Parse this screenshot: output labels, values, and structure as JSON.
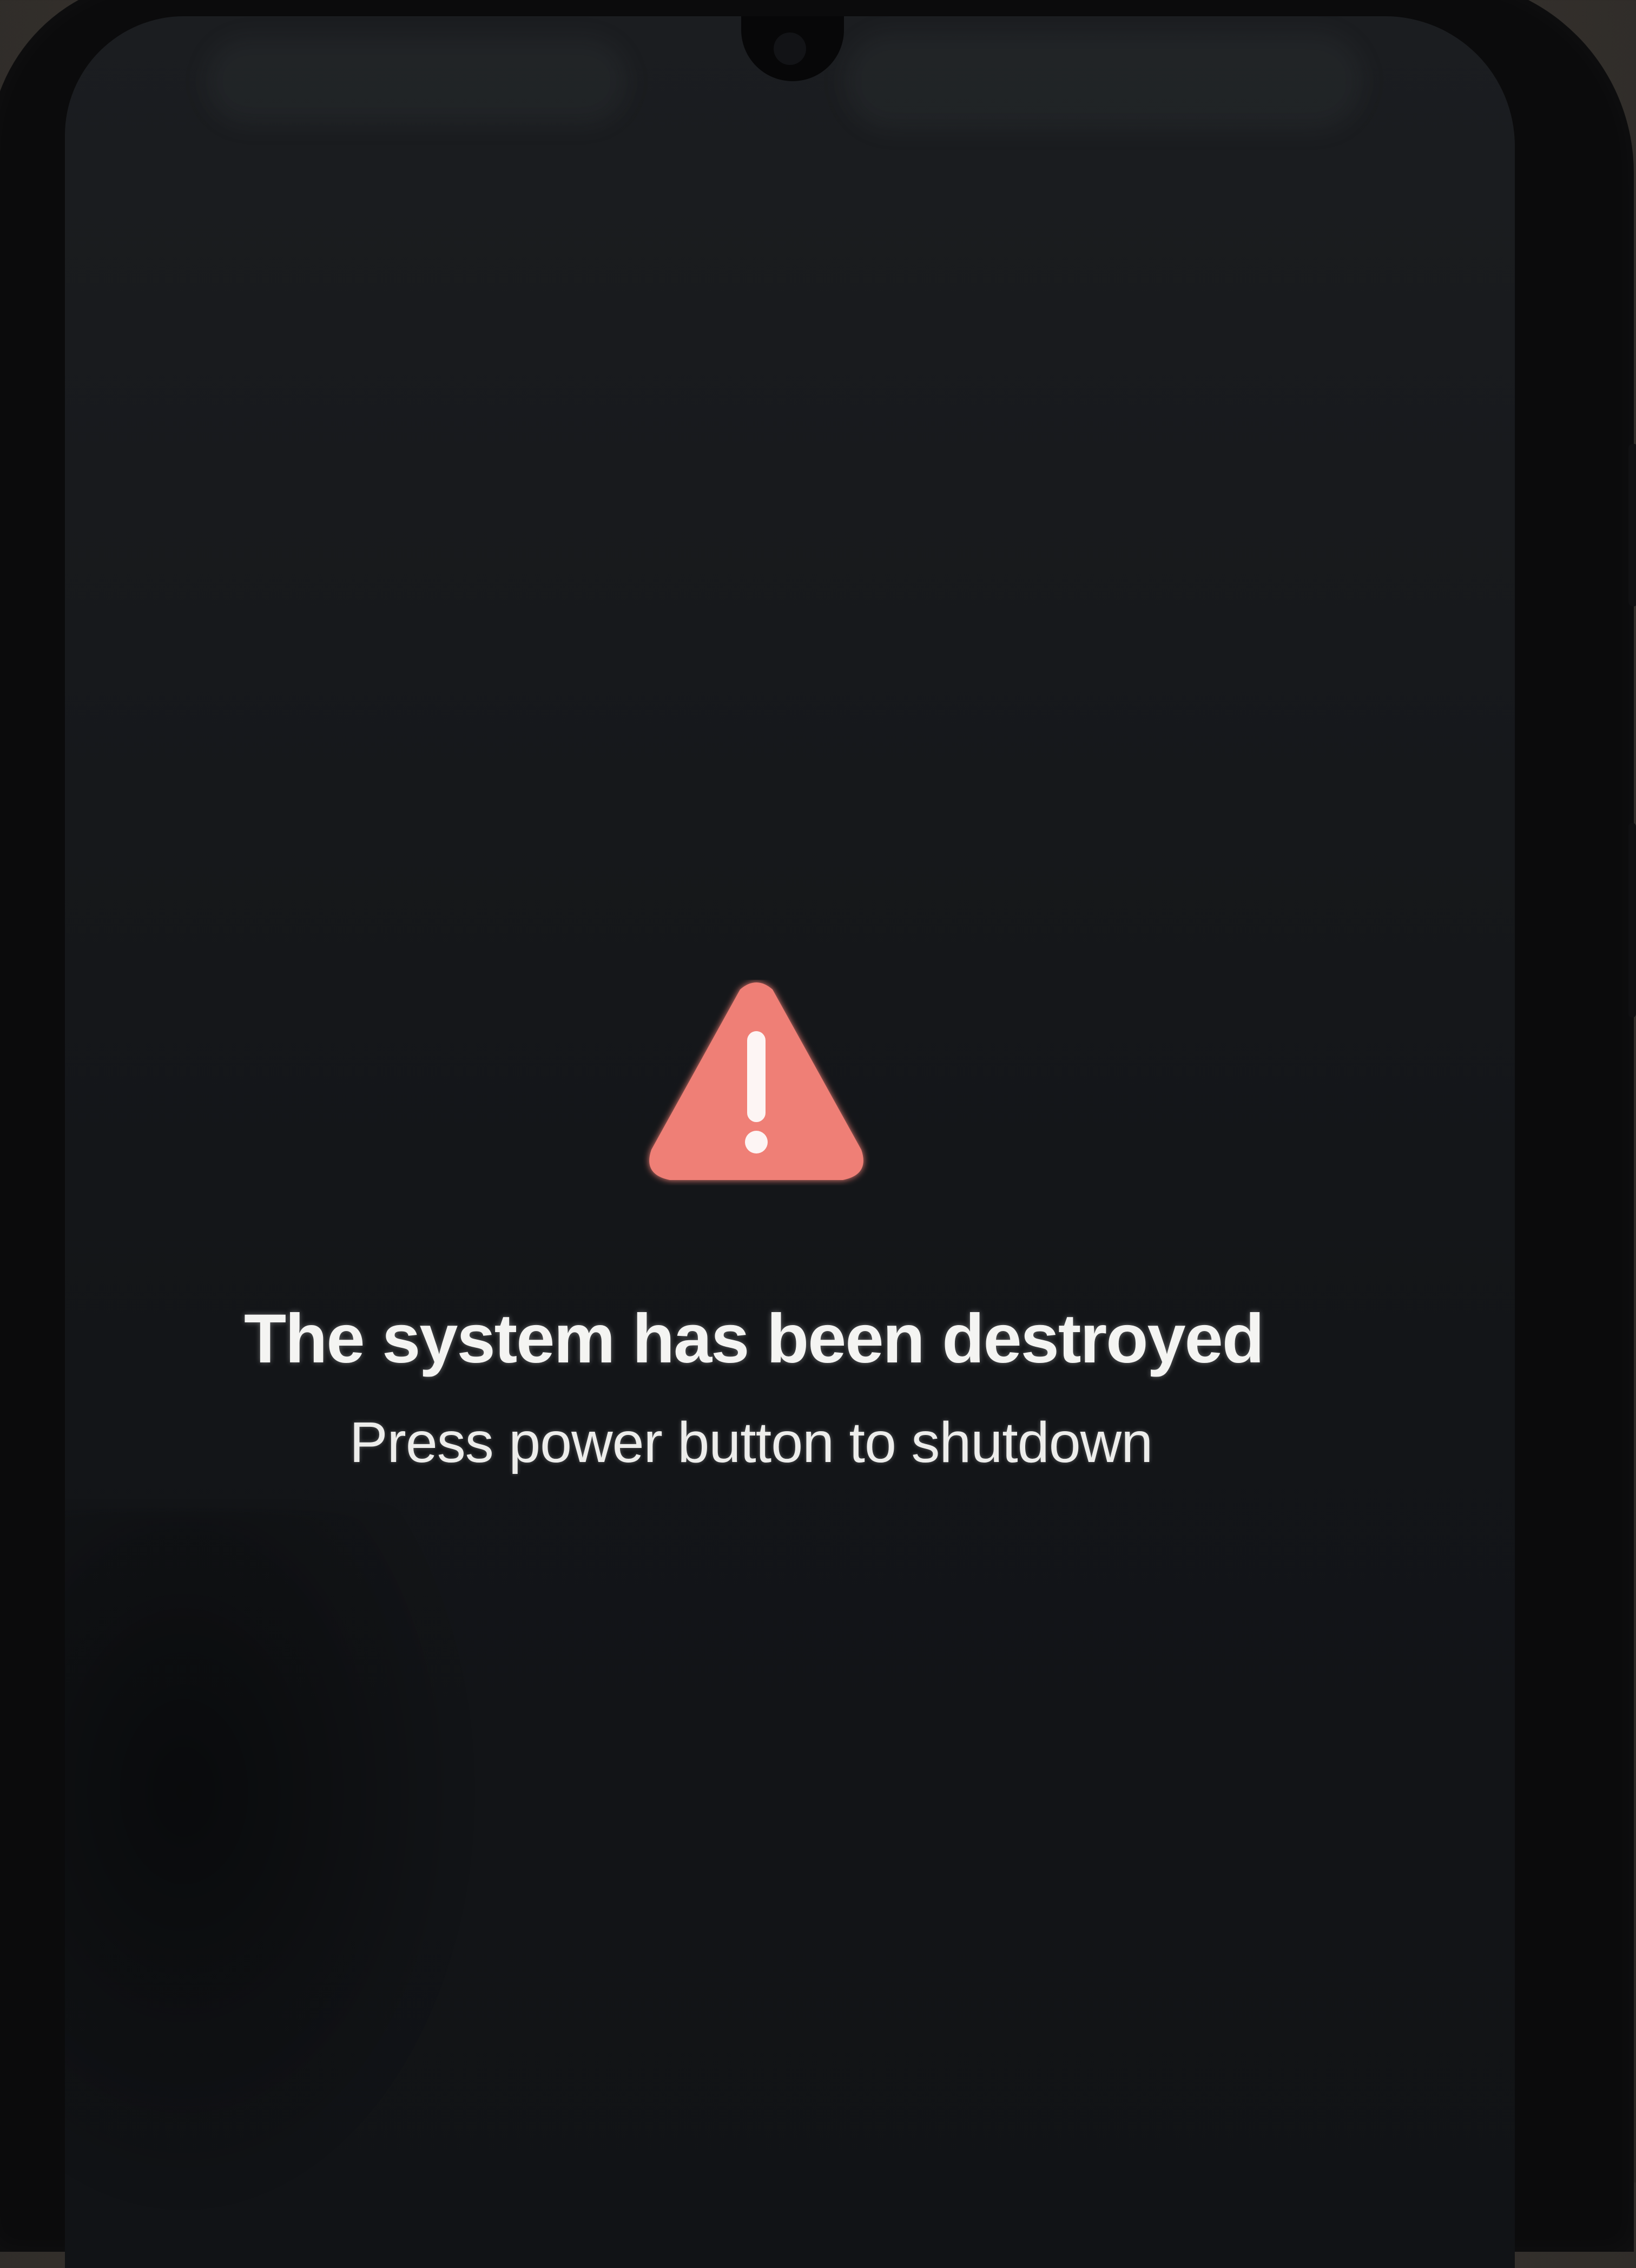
{
  "error_screen": {
    "title": "The system has been destroyed",
    "subtitle": "Press power button to shutdown",
    "icon": "warning-triangle-icon",
    "icon_color": "#ef7f76",
    "icon_mark_color": "#fdf5f4",
    "text_color": "#f4f4f2",
    "background_color": "#16181b"
  }
}
